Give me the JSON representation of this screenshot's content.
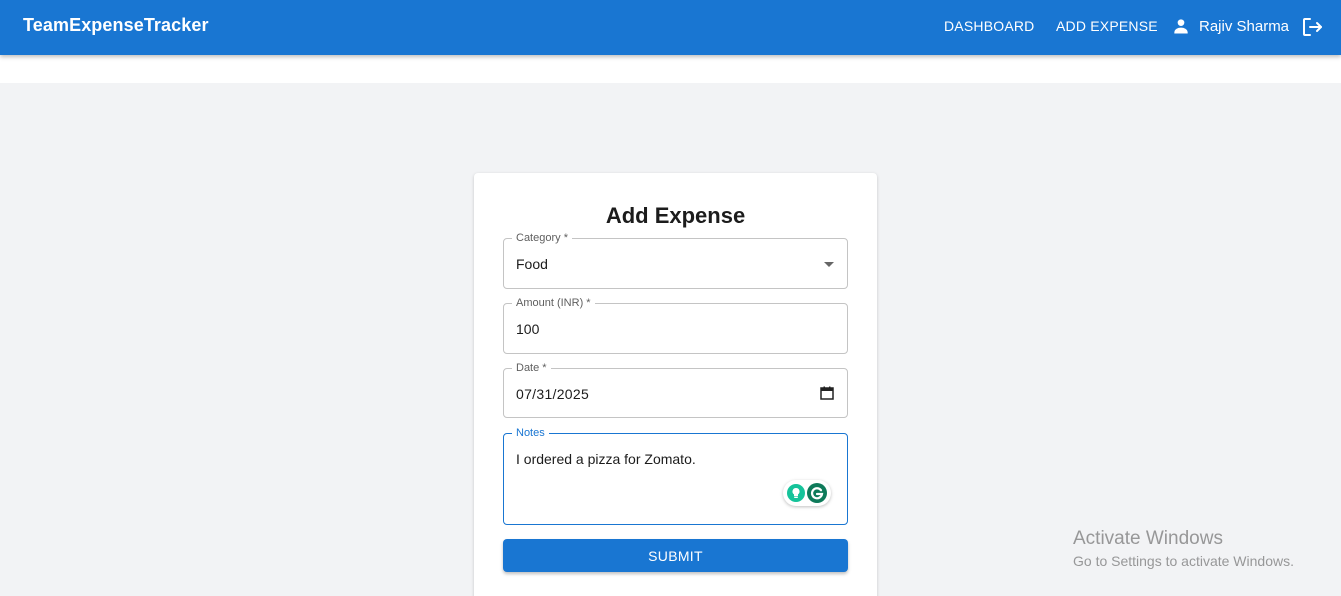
{
  "header": {
    "brand": "TeamExpenseTracker",
    "nav": {
      "dashboard": "DASHBOARD",
      "add_expense": "ADD EXPENSE"
    },
    "user_name": "Rajiv Sharma",
    "icons": {
      "user": "person-icon",
      "logout": "logout-icon"
    }
  },
  "form": {
    "title": "Add Expense",
    "category": {
      "label": "Category *",
      "value": "Food"
    },
    "amount": {
      "label": "Amount (INR) *",
      "value": "100"
    },
    "date": {
      "label": "Date *",
      "value": "07/31/2025"
    },
    "notes": {
      "label": "Notes",
      "value": "I ordered a pizza for Zomato."
    },
    "submit_label": "SUBMIT"
  },
  "watermark": {
    "title": "Activate Windows",
    "subtitle": "Go to Settings to activate Windows."
  },
  "colors": {
    "primary": "#1976d2",
    "background": "#f2f3f5"
  }
}
